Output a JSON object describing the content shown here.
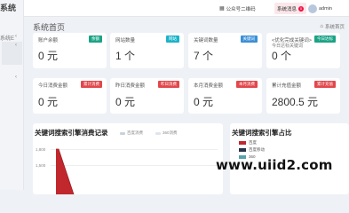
{
  "sidebar": {
    "brand": "系统",
    "menu_text": "系统E",
    "arrow_glyph": "‹"
  },
  "topbar": {
    "qr_label": "公众号二维码",
    "msg_label": "系统消息",
    "msg_badge": "0",
    "user_name": "admin"
  },
  "page": {
    "title": "系统首页",
    "breadcrumb": "系统首页"
  },
  "cards": [
    {
      "label": "账户余额",
      "tag": "余额",
      "tag_color": "#1aa385",
      "value": "0 元"
    },
    {
      "label": "网站数量",
      "tag": "网站",
      "tag_color": "#1bb3c9",
      "value": "1 个"
    },
    {
      "label": "关键词数量",
      "tag": "关键词",
      "tag_color": "#3b8fd6",
      "value": "7 个"
    },
    {
      "label": "<优化完成关键词>",
      "label2": "今日达标关键词",
      "tag": "今日达标",
      "tag_color": "#1aa385",
      "value": "0 个"
    },
    {
      "label": "今日消费金额",
      "tag": "累计消费",
      "tag_color": "#e2474b",
      "value": "0 元"
    },
    {
      "label": "昨日消费金额",
      "tag": "昨日消费",
      "tag_color": "#e2474b",
      "value": "0 元"
    },
    {
      "label": "本月消费金额",
      "tag": "本月消费",
      "tag_color": "#e2474b",
      "value": "0 元"
    },
    {
      "label": "累计充值金额",
      "tag": "累计充值",
      "tag_color": "#e2474b",
      "value": "2800.5 元"
    }
  ],
  "left_panel": {
    "title": "关键词搜索引擎消费记录",
    "legend": [
      {
        "name": "百度消费",
        "color": "#c9d2dc"
      },
      {
        "name": "360消费",
        "color": "#dfe5ea"
      }
    ],
    "y_ticks": [
      "1,800",
      "1,500"
    ]
  },
  "right_panel": {
    "title": "关键词搜索引擎占比",
    "legend": [
      {
        "name": "百度",
        "color": "#c0282d"
      },
      {
        "name": "百度移动",
        "color": "#273447"
      },
      {
        "name": "360",
        "color": "#56a3ad"
      }
    ]
  },
  "watermark": "www.uiid2.com"
}
